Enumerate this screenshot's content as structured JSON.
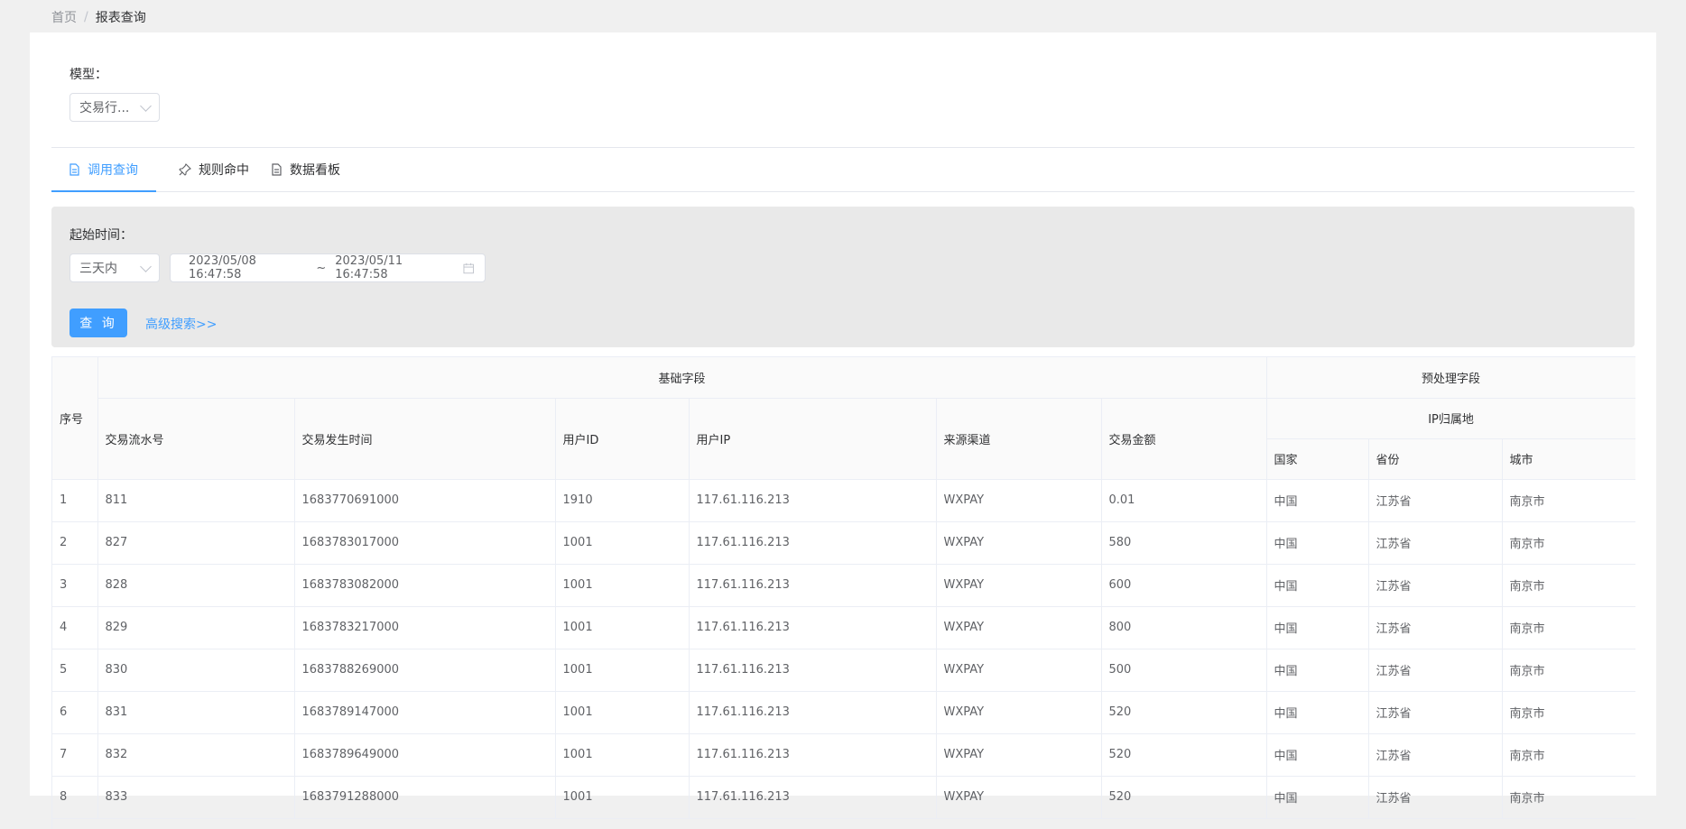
{
  "breadcrumb": {
    "home": "首页",
    "separator": "/",
    "current": "报表查询"
  },
  "model": {
    "label": "模型：",
    "selected": "交易行..."
  },
  "tabs": [
    {
      "label": "调用查询",
      "icon": "document-icon",
      "active": true
    },
    {
      "label": "规则命中",
      "icon": "pin-icon",
      "active": false
    },
    {
      "label": "数据看板",
      "icon": "document-icon",
      "active": false
    }
  ],
  "query": {
    "start_label": "起始时间：",
    "range_selected": "三天内",
    "date_start": "2023/05/08 16:47:58",
    "date_sep": "~",
    "date_end": "2023/05/11 16:47:58",
    "search_label": "查 询",
    "advanced_label": "高级搜索>>"
  },
  "table": {
    "group_basic": "基础字段",
    "group_pre": "预处理字段",
    "sub_group_ip": "IP归属地",
    "columns": {
      "index": "序号",
      "serial": "交易流水号",
      "time": "交易发生时间",
      "uid": "用户ID",
      "uip": "用户IP",
      "channel": "来源渠道",
      "amount": "交易金额",
      "country": "国家",
      "province": "省份",
      "city": "城市"
    },
    "rows": [
      [
        "1",
        "811",
        "1683770691000",
        "1910",
        "117.61.116.213",
        "WXPAY",
        "0.01",
        "中国",
        "江苏省",
        "南京市"
      ],
      [
        "2",
        "827",
        "1683783017000",
        "1001",
        "117.61.116.213",
        "WXPAY",
        "580",
        "中国",
        "江苏省",
        "南京市"
      ],
      [
        "3",
        "828",
        "1683783082000",
        "1001",
        "117.61.116.213",
        "WXPAY",
        "600",
        "中国",
        "江苏省",
        "南京市"
      ],
      [
        "4",
        "829",
        "1683783217000",
        "1001",
        "117.61.116.213",
        "WXPAY",
        "800",
        "中国",
        "江苏省",
        "南京市"
      ],
      [
        "5",
        "830",
        "1683788269000",
        "1001",
        "117.61.116.213",
        "WXPAY",
        "500",
        "中国",
        "江苏省",
        "南京市"
      ],
      [
        "6",
        "831",
        "1683789147000",
        "1001",
        "117.61.116.213",
        "WXPAY",
        "520",
        "中国",
        "江苏省",
        "南京市"
      ],
      [
        "7",
        "832",
        "1683789649000",
        "1001",
        "117.61.116.213",
        "WXPAY",
        "520",
        "中国",
        "江苏省",
        "南京市"
      ],
      [
        "8",
        "833",
        "1683791288000",
        "1001",
        "117.61.116.213",
        "WXPAY",
        "520",
        "中国",
        "江苏省",
        "南京市"
      ]
    ]
  },
  "colors": {
    "accent": "#409eff",
    "page_bg": "#f0f0f0",
    "query_bg": "#e9e9e9"
  }
}
